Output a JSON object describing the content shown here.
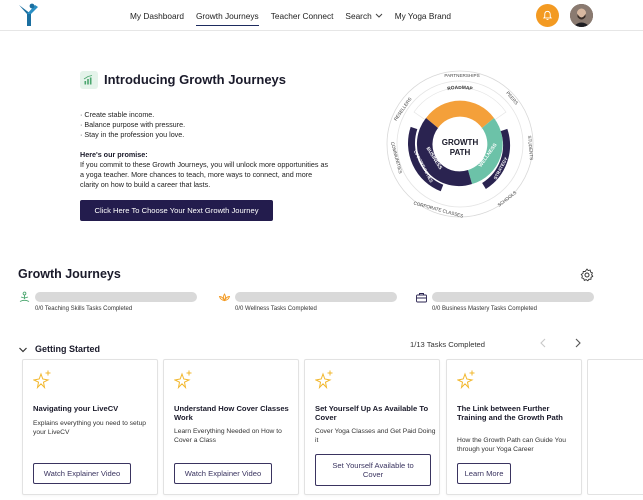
{
  "nav": {
    "links": [
      {
        "label": "My Dashboard",
        "active": false
      },
      {
        "label": "Growth Journeys",
        "active": true
      },
      {
        "label": "Teacher Connect",
        "active": false
      },
      {
        "label": "Search",
        "active": false,
        "dropdown": true
      },
      {
        "label": "My Yoga Brand",
        "active": false
      }
    ],
    "notification_color": "#f39a22"
  },
  "intro": {
    "title": "Introducing Growth Journeys",
    "bullets": [
      "· Create stable income.",
      "· Balance purpose with pressure.",
      "· Stay in the profession you love."
    ],
    "promise_title": "Here's our promise:",
    "promise_text": "If you commit to these Growth Journeys, you will unlock more opportunities as a yoga teacher. More chances to teach, more ways to connect, and more clarity on how to build a career that lasts.",
    "cta_label": "Click Here To Choose Your Next Growth Journey"
  },
  "wheel": {
    "center_line1": "GROWTH",
    "center_line2": "PATH",
    "inner_segments": [
      "TEACHING SKILLS",
      "WELLNESS",
      "BUSINESS"
    ],
    "middle_segments": [
      "ROADMAP",
      "STRATEGY",
      "OPPORTUNITIES"
    ],
    "outer_labels": [
      "PARTNERSHIPS",
      "PEERS",
      "STUDENTS",
      "SCHOOLS",
      "CORPORATE CLASSES",
      "COMMUNITIES",
      "RESELLERS"
    ],
    "colors": {
      "orange": "#f4a03a",
      "teal": "#6cc2a8",
      "navy": "#2a2350"
    }
  },
  "growth_journeys": {
    "title": "Growth Journeys",
    "progress": [
      {
        "label": "0/0 Teaching Skills Tasks Completed",
        "icon": "lotus-figure-icon",
        "value": 0
      },
      {
        "label": "0/0 Wellness Tasks Completed",
        "icon": "lotus-flower-icon",
        "value": 0
      },
      {
        "label": "0/0 Business Mastery Tasks Completed",
        "icon": "briefcase-icon",
        "value": 0
      }
    ]
  },
  "getting_started": {
    "title": "Getting Started",
    "tasks_completed": "1/13 Tasks Completed",
    "cards": [
      {
        "title": "Navigating your LiveCV",
        "description": "Explains everything you need to setup your LiveCV",
        "button": "Watch Explainer Video"
      },
      {
        "title": "Understand How Cover Classes Work",
        "description": "Learn Everything Needed on How to Cover a Class",
        "button": "Watch Explainer Video"
      },
      {
        "title": "Set Yourself Up As Available To Cover",
        "description": "Cover Yoga Classes and Get Paid Doing it",
        "button": "Set Yourself Available to Cover"
      },
      {
        "title": "The Link between Further Training and the Growth Path",
        "description": "How the Growth Path can Guide You through your Yoga Career",
        "button": "Learn More"
      }
    ]
  }
}
